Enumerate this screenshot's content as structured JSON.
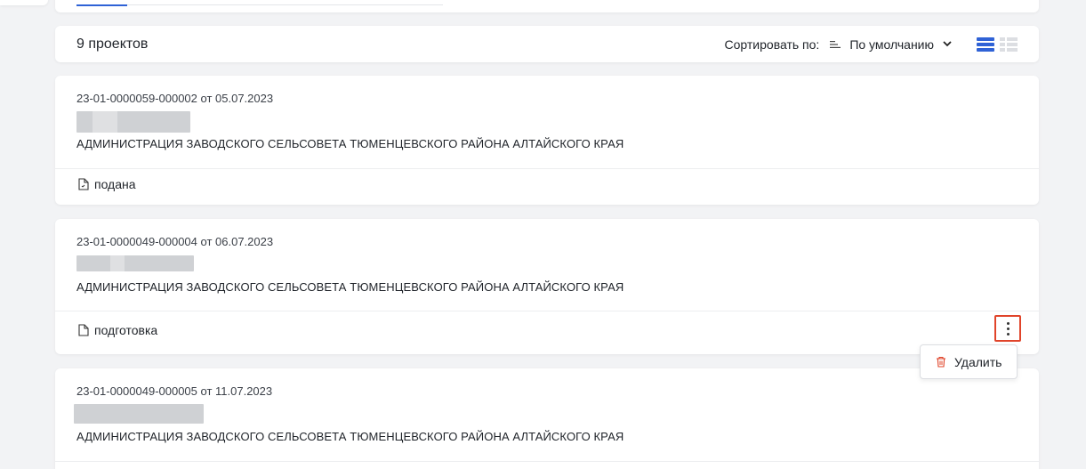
{
  "header": {
    "count_label": "9 проектов",
    "sort_label": "Сортировать по:",
    "sort_value": "По умолчанию",
    "active_view": "list"
  },
  "projects": [
    {
      "number": "23-01-0000059-000002 от 05.07.2023",
      "organization": "АДМИНИСТРАЦИЯ ЗАВОДСКОГО СЕЛЬСОВЕТА ТЮМЕНЦЕВСКОГО РАЙОНА АЛТАЙСКОГО КРАЯ",
      "status": "подана",
      "status_icon": "file-check-icon"
    },
    {
      "number": "23-01-0000049-000004 от 06.07.2023",
      "organization": "АДМИНИСТРАЦИЯ ЗАВОДСКОГО СЕЛЬСОВЕТА ТЮМЕНЦЕВСКОГО РАЙОНА АЛТАЙСКОГО КРАЯ",
      "status": "подготовка",
      "status_icon": "file-icon"
    },
    {
      "number": "23-01-0000049-000005 от 11.07.2023",
      "organization": "АДМИНИСТРАЦИЯ ЗАВОДСКОГО СЕЛЬСОВЕТА ТЮМЕНЦЕВСКОГО РАЙОНА АЛТАЙСКОГО КРАЯ"
    }
  ],
  "context_menu": {
    "delete_label": "Удалить",
    "delete_icon": "trash-icon"
  },
  "colors": {
    "accent": "#2f62d6",
    "highlight": "#e0442a",
    "danger_icon": "#e0442a"
  }
}
